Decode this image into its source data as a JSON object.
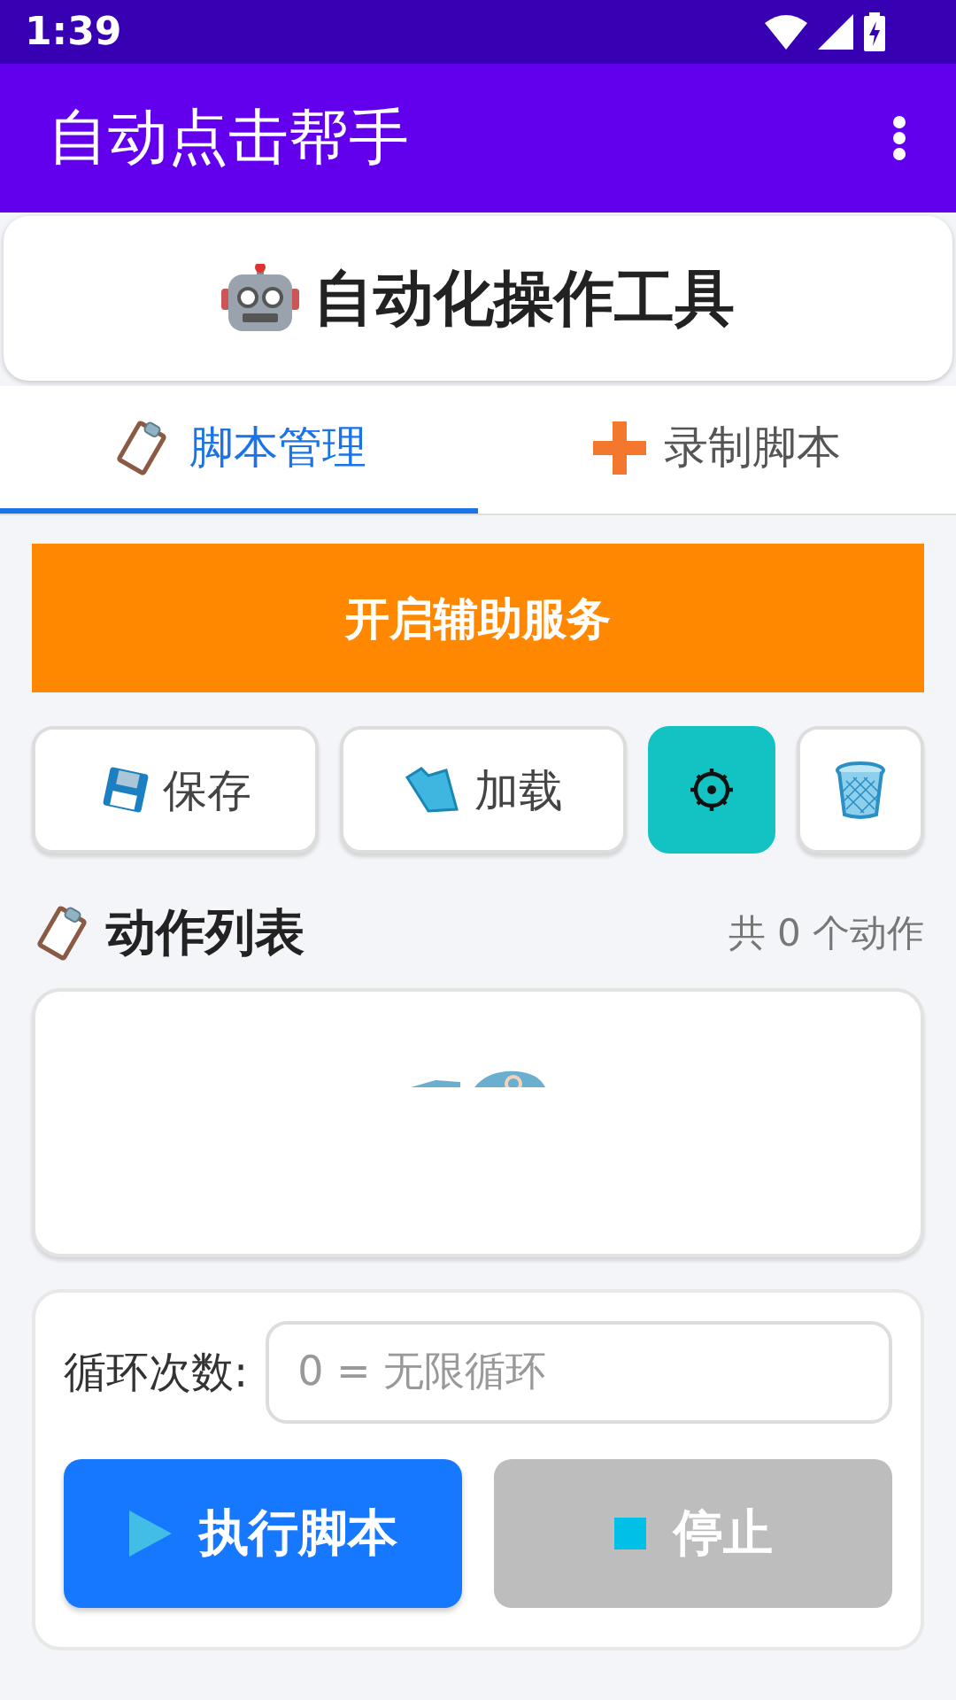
{
  "status_bar": {
    "time": "1:39"
  },
  "app_bar": {
    "title": "自动点击帮手"
  },
  "header": {
    "title": "自动化操作工具"
  },
  "tabs": [
    {
      "label": "脚本管理",
      "selected": true
    },
    {
      "label": "录制脚本",
      "selected": false
    }
  ],
  "service_button": "开启辅助服务",
  "actions": [
    {
      "kind": "labeled",
      "label": "保存"
    },
    {
      "kind": "labeled",
      "label": "加载"
    },
    {
      "kind": "accent"
    },
    {
      "kind": "plain"
    }
  ],
  "action_list": {
    "title": "动作列表",
    "count": "共 0 个动作"
  },
  "loop": {
    "label": "循环次数:",
    "placeholder": "0 = 无限循环"
  },
  "run_buttons": [
    {
      "label": "执行脚本",
      "disabled": false
    },
    {
      "label": "停止",
      "disabled": true
    }
  ]
}
